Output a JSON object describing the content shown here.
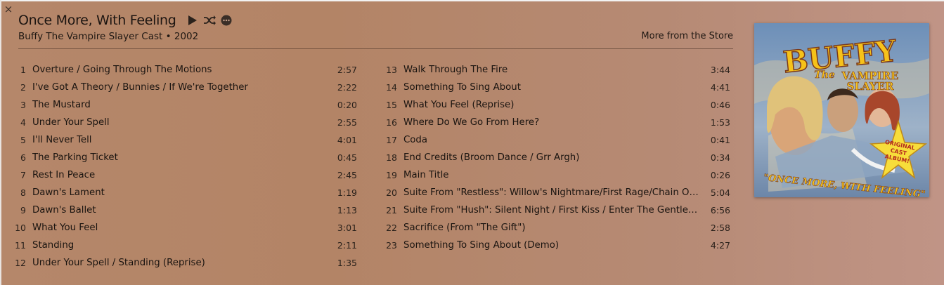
{
  "window": {
    "close_glyph": "×"
  },
  "header": {
    "title": "Once More, With Feeling",
    "subtitle": "Buffy The Vampire Slayer Cast • 2002",
    "store_link": "More from the Store",
    "icons": [
      "play-icon",
      "shuffle-icon",
      "more-icon"
    ]
  },
  "artwork": {
    "logo_text": "BUFFY",
    "logo_the": "The",
    "logo_line1": "VAMPIRE",
    "logo_line2": "SLAYER",
    "star_text_1": "ORIGINAL",
    "star_text_2": "CAST",
    "star_text_3": "ALBUM!",
    "tagline": "\"ONCE MORE, WITH FEELING\""
  },
  "tracks_left": [
    {
      "num": "1",
      "name": "Overture / Going Through The Motions",
      "duration": "2:57"
    },
    {
      "num": "2",
      "name": "I've Got A Theory / Bunnies / If We're Together",
      "duration": "2:22"
    },
    {
      "num": "3",
      "name": "The Mustard",
      "duration": "0:20"
    },
    {
      "num": "4",
      "name": "Under Your Spell",
      "duration": "2:55"
    },
    {
      "num": "5",
      "name": "I'll Never Tell",
      "duration": "4:01"
    },
    {
      "num": "6",
      "name": "The Parking Ticket",
      "duration": "0:45"
    },
    {
      "num": "7",
      "name": "Rest In Peace",
      "duration": "2:45"
    },
    {
      "num": "8",
      "name": "Dawn's Lament",
      "duration": "1:19"
    },
    {
      "num": "9",
      "name": "Dawn's Ballet",
      "duration": "1:13"
    },
    {
      "num": "10",
      "name": "What You Feel",
      "duration": "3:01"
    },
    {
      "num": "11",
      "name": "Standing",
      "duration": "2:11"
    },
    {
      "num": "12",
      "name": "Under Your Spell / Standing (Reprise)",
      "duration": "1:35"
    }
  ],
  "tracks_right": [
    {
      "num": "13",
      "name": "Walk Through The Fire",
      "duration": "3:44"
    },
    {
      "num": "14",
      "name": "Something To Sing About",
      "duration": "4:41"
    },
    {
      "num": "15",
      "name": "What You Feel (Reprise)",
      "duration": "0:46"
    },
    {
      "num": "16",
      "name": "Where Do We Go From Here?",
      "duration": "1:53"
    },
    {
      "num": "17",
      "name": "Coda",
      "duration": "0:41"
    },
    {
      "num": "18",
      "name": "End Credits (Broom Dance / Grr Argh)",
      "duration": "0:34"
    },
    {
      "num": "19",
      "name": "Main Title",
      "duration": "0:26"
    },
    {
      "num": "20",
      "name": "Suite From \"Restless\": Willow's Nightmare/First Rage/Chain Of...",
      "duration": "5:04"
    },
    {
      "num": "21",
      "name": "Suite From \"Hush\": Silent Night / First Kiss / Enter The Gentleme...",
      "duration": "6:56"
    },
    {
      "num": "22",
      "name": "Sacrifice (From \"The Gift\")",
      "duration": "2:58"
    },
    {
      "num": "23",
      "name": "Something To Sing About (Demo)",
      "duration": "4:27"
    }
  ]
}
